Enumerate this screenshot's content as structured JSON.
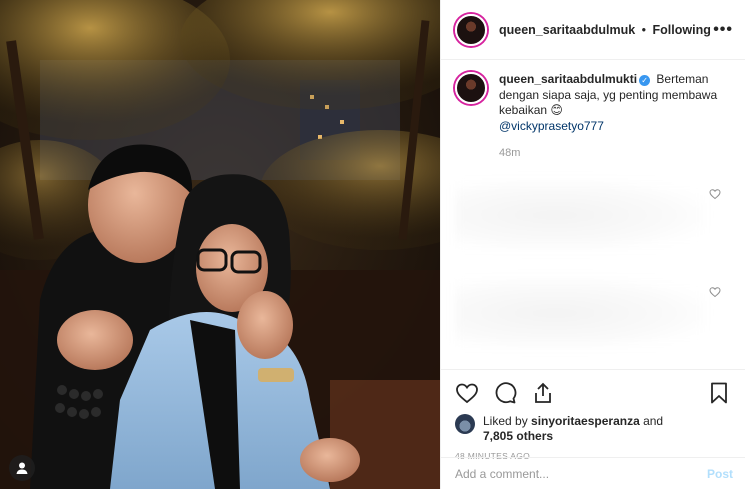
{
  "post": {
    "author": "queen_saritaabdulmuk",
    "separator": "•",
    "follow_status": "Following",
    "more_label": "•••"
  },
  "caption": {
    "username": "queen_saritaabdulmukti",
    "verified_mark": "✓",
    "text": "Berteman dengan siapa saja, yg penting membawa kebaikan 😊",
    "mention": "@vickyprasetyo777",
    "time": "48m"
  },
  "likes": {
    "prefix": "Liked by ",
    "user": "sinyoritaesperanza",
    "conjunction": " and",
    "others": "7,805 others"
  },
  "timestamp": "48 MINUTES AGO",
  "comment_box": {
    "placeholder": "Add a comment...",
    "post_label": "Post"
  },
  "icons": {
    "like": "heart-icon",
    "comment": "comment-icon",
    "share": "share-icon",
    "save": "bookmark-icon",
    "tag": "user-tag-icon"
  },
  "colors": {
    "verified": "#3897f0",
    "mention": "#003569",
    "post_button_disabled": "#b2dffc",
    "secondary_text": "#999999"
  }
}
